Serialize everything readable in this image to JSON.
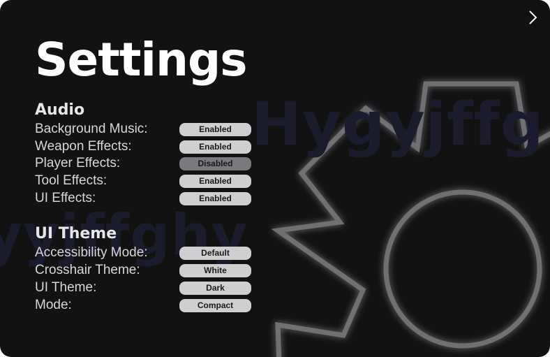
{
  "title": "Settings",
  "watermark": {
    "line1": "Hygyjffg",
    "line2": "yyjffghy"
  },
  "audio": {
    "heading": "Audio",
    "items": [
      {
        "label": "Background Music:",
        "value": "Enabled"
      },
      {
        "label": "Weapon Effects:",
        "value": "Enabled"
      },
      {
        "label": "Player Effects:",
        "value": "Disabled"
      },
      {
        "label": "Tool Effects:",
        "value": "Enabled"
      },
      {
        "label": "UI Effects:",
        "value": "Enabled"
      }
    ]
  },
  "theme": {
    "heading": "UI Theme",
    "items": [
      {
        "label": "Accessibility Mode:",
        "value": "Default"
      },
      {
        "label": "Crosshair Theme:",
        "value": "White"
      },
      {
        "label": "UI Theme:",
        "value": "Dark"
      },
      {
        "label": "Mode:",
        "value": "Compact"
      }
    ]
  },
  "icons": {
    "next": "chevron-right-icon",
    "background": "gear-icon"
  },
  "colors": {
    "panel_bg": "#121213",
    "pill_enabled": "#cfcfd2",
    "pill_disabled": "#7a7a7e",
    "gear_stroke": "#6f6f73"
  }
}
